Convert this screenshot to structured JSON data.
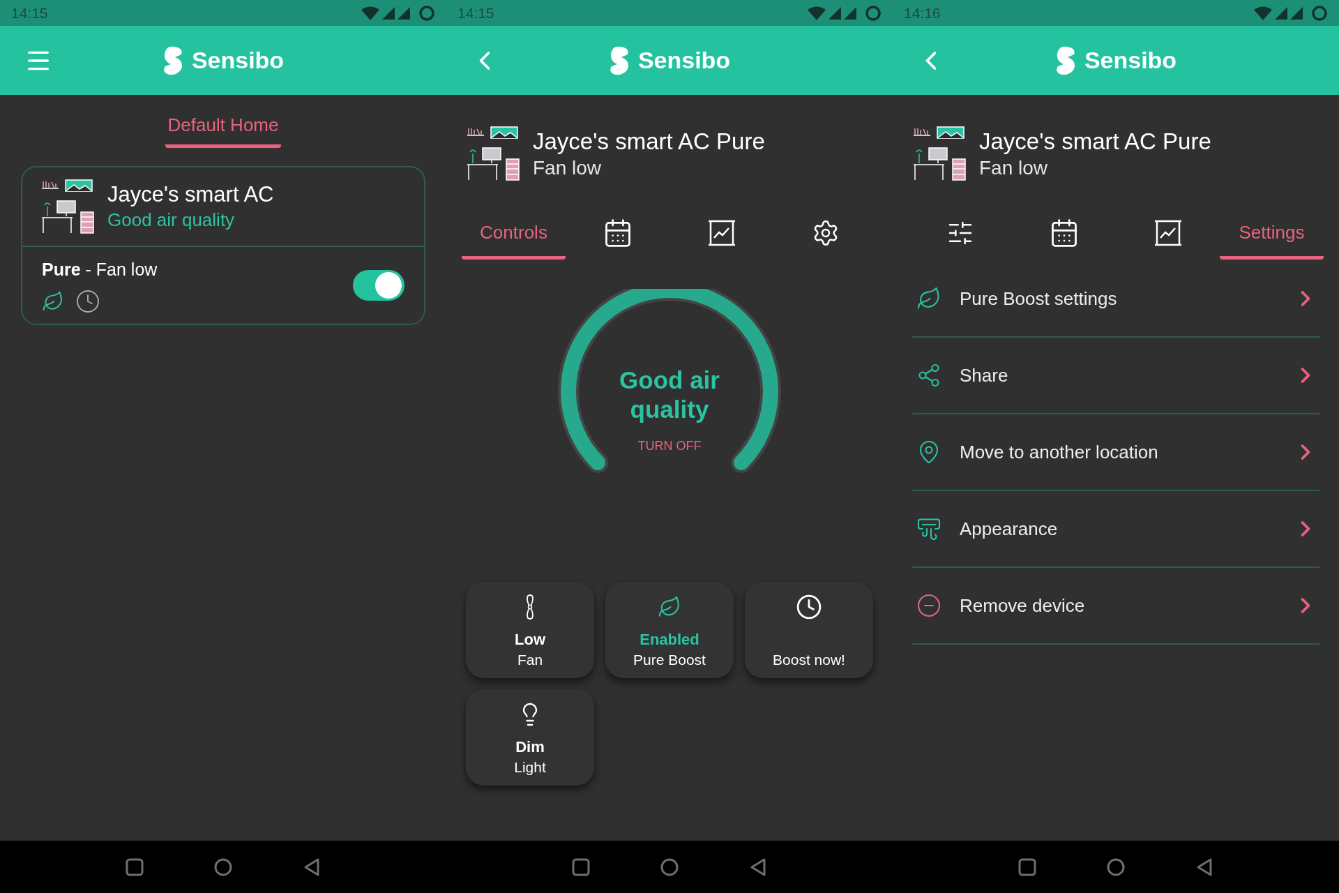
{
  "screens": [
    {
      "kind": "home",
      "status_bar": {
        "time": "14:15"
      },
      "app_bar": {
        "kind": "menu",
        "title": "Sensibo"
      },
      "home_tab": {
        "label": "Default Home",
        "selected": true
      },
      "device_card": {
        "name": "Jayce's smart AC",
        "status": "Good air quality",
        "mode_line": "**Pure** - Fan low",
        "on": true
      }
    },
    {
      "kind": "controls",
      "status_bar": {
        "time": "14:15"
      },
      "app_bar": {
        "kind": "back",
        "title": "Sensibo"
      },
      "device": {
        "name": "Jayce's smart AC Pure",
        "status": "Fan low"
      },
      "tabs": [
        {
          "kind": "text",
          "label": "Controls",
          "selected": true
        },
        {
          "kind": "calendar",
          "selected": false
        },
        {
          "kind": "chart",
          "selected": false
        },
        {
          "kind": "gear",
          "selected": false
        }
      ],
      "gauge": {
        "title": "Good air quality",
        "action": "TURN OFF"
      },
      "tiles": [
        {
          "kind": "fan",
          "value": "Low",
          "label": "Fan",
          "active": false
        },
        {
          "kind": "leaf",
          "value": "Enabled",
          "label": "Pure Boost",
          "active": true
        },
        {
          "kind": "clock",
          "label": "Boost now!",
          "active": false
        },
        {
          "kind": "bulb",
          "value": "Dim",
          "label": "Light",
          "active": false
        }
      ]
    },
    {
      "kind": "settings",
      "status_bar": {
        "time": "14:16"
      },
      "app_bar": {
        "kind": "back",
        "title": "Sensibo"
      },
      "device": {
        "name": "Jayce's smart AC Pure",
        "status": "Fan low"
      },
      "tabs": [
        {
          "kind": "sliders",
          "selected": false
        },
        {
          "kind": "calendar",
          "selected": false
        },
        {
          "kind": "chart",
          "selected": false
        },
        {
          "kind": "text",
          "label": "Settings",
          "selected": true
        }
      ],
      "menu": [
        {
          "kind": "leaf",
          "label": "Pure Boost settings"
        },
        {
          "kind": "share",
          "label": "Share"
        },
        {
          "kind": "pin",
          "label": "Move to another location"
        },
        {
          "kind": "ac",
          "label": "Appearance"
        },
        {
          "kind": "remove",
          "label": "Remove device"
        }
      ]
    }
  ]
}
